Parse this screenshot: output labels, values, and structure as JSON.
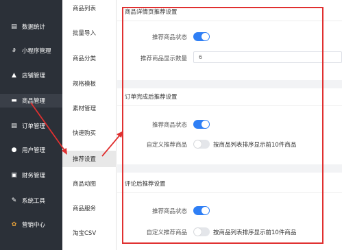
{
  "colors": {
    "sidebar_bg": "#2b3038",
    "accent_blue": "#2f7ff5",
    "annotation_red": "#e03030"
  },
  "sidebar": {
    "items": [
      {
        "icon": "chart-icon",
        "glyph": "▤",
        "label": "数据统计"
      },
      {
        "icon": "link-icon",
        "glyph": "∂",
        "label": "小程序管理"
      },
      {
        "icon": "store-icon",
        "glyph": "▲",
        "label": "店铺管理"
      },
      {
        "icon": "goods-icon",
        "glyph": "▬",
        "label": "商品管理"
      },
      {
        "icon": "order-icon",
        "glyph": "▤",
        "label": "订单管理"
      },
      {
        "icon": "user-icon",
        "glyph": "●",
        "label": "用户管理"
      },
      {
        "icon": "finance-icon",
        "glyph": "▣",
        "label": "财务管理"
      },
      {
        "icon": "tools-icon",
        "glyph": "✎",
        "label": "系统工具"
      },
      {
        "icon": "marketing-icon",
        "glyph": "✿",
        "label": "营销中心"
      }
    ]
  },
  "submenu": {
    "items": [
      {
        "label": "商品列表"
      },
      {
        "label": "批量导入"
      },
      {
        "label": "商品分类"
      },
      {
        "label": "规格模板"
      },
      {
        "label": "素材管理"
      },
      {
        "label": "快速购买"
      },
      {
        "label": "推荐设置"
      },
      {
        "label": "商品动图"
      },
      {
        "label": "商品服务"
      },
      {
        "label": "淘宝CSV"
      }
    ],
    "active_index": 6
  },
  "sections": {
    "detail": {
      "title": "商品详情页推荐设置",
      "status_label": "推荐商品状态",
      "status_on": true,
      "count_label": "推荐商品显示数量",
      "count_value": "6"
    },
    "order": {
      "title": "订单完成后推荐设置",
      "status_label": "推荐商品状态",
      "status_on": true,
      "custom_label": "自定义推荐商品",
      "custom_on": false,
      "custom_text": "按商品列表排序显示前10件商品"
    },
    "review": {
      "title": "评论后推荐设置",
      "status_label": "推荐商品状态",
      "status_on": true,
      "custom_label": "自定义推荐商品",
      "custom_on": false,
      "custom_text": "按商品列表排序显示前10件商品"
    }
  }
}
